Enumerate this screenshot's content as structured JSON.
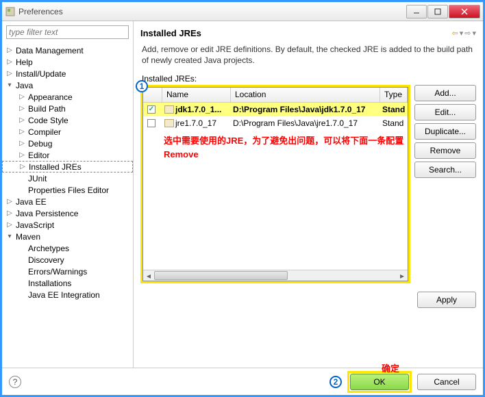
{
  "window": {
    "title": "Preferences"
  },
  "filter": {
    "placeholder": "type filter text"
  },
  "tree": [
    {
      "indent": 0,
      "exp": "▷",
      "label": "Data Management"
    },
    {
      "indent": 0,
      "exp": "▷",
      "label": "Help"
    },
    {
      "indent": 0,
      "exp": "▷",
      "label": "Install/Update"
    },
    {
      "indent": 0,
      "exp": "▾",
      "label": "Java"
    },
    {
      "indent": 1,
      "exp": "▷",
      "label": "Appearance"
    },
    {
      "indent": 1,
      "exp": "▷",
      "label": "Build Path"
    },
    {
      "indent": 1,
      "exp": "▷",
      "label": "Code Style"
    },
    {
      "indent": 1,
      "exp": "▷",
      "label": "Compiler"
    },
    {
      "indent": 1,
      "exp": "▷",
      "label": "Debug"
    },
    {
      "indent": 1,
      "exp": "▷",
      "label": "Editor"
    },
    {
      "indent": 1,
      "exp": "▷",
      "label": "Installed JREs",
      "sel": true
    },
    {
      "indent": 1,
      "exp": "",
      "label": "JUnit"
    },
    {
      "indent": 1,
      "exp": "",
      "label": "Properties Files Editor"
    },
    {
      "indent": 0,
      "exp": "▷",
      "label": "Java EE"
    },
    {
      "indent": 0,
      "exp": "▷",
      "label": "Java Persistence"
    },
    {
      "indent": 0,
      "exp": "▷",
      "label": "JavaScript"
    },
    {
      "indent": 0,
      "exp": "▾",
      "label": "Maven"
    },
    {
      "indent": 1,
      "exp": "",
      "label": "Archetypes"
    },
    {
      "indent": 1,
      "exp": "",
      "label": "Discovery"
    },
    {
      "indent": 1,
      "exp": "",
      "label": "Errors/Warnings"
    },
    {
      "indent": 1,
      "exp": "",
      "label": "Installations"
    },
    {
      "indent": 1,
      "exp": "",
      "label": "Java EE Integration"
    }
  ],
  "page": {
    "title": "Installed JREs",
    "description": "Add, remove or edit JRE definitions. By default, the checked JRE is added to the build path of newly created Java projects.",
    "table_label": "Installed JREs:",
    "columns": {
      "name": "Name",
      "location": "Location",
      "type": "Type"
    },
    "rows": [
      {
        "checked": true,
        "name": "jdk1.7.0_1...",
        "location": "D:\\Program Files\\Java\\jdk1.7.0_17",
        "type": "Stand",
        "hl": true
      },
      {
        "checked": false,
        "name": "jre1.7.0_17",
        "location": "D:\\Program Files\\Java\\jre1.7.0_17",
        "type": "Stand",
        "hl": false
      }
    ],
    "annotation": "选中需要使用的JRE，为了避免出问题，可以将下面一条配置Remove"
  },
  "buttons": {
    "add": "Add...",
    "edit": "Edit...",
    "duplicate": "Duplicate...",
    "remove": "Remove",
    "search": "Search...",
    "apply": "Apply",
    "ok": "OK",
    "cancel": "Cancel"
  },
  "callouts": {
    "one": "1",
    "two": "2",
    "ok_label": "确定"
  }
}
